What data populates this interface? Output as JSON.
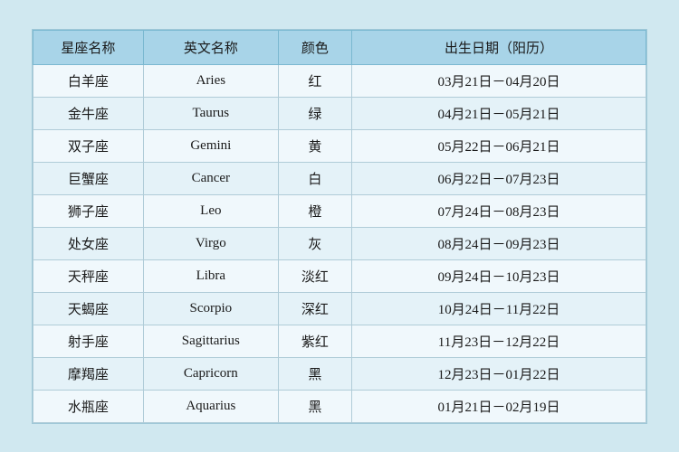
{
  "table": {
    "headers": [
      "星座名称",
      "英文名称",
      "颜色",
      "出生日期（阳历）"
    ],
    "rows": [
      {
        "name": "白羊座",
        "english": "Aries",
        "color": "红",
        "date": "03月21日－04月20日"
      },
      {
        "name": "金牛座",
        "english": "Taurus",
        "color": "绿",
        "date": "04月21日－05月21日"
      },
      {
        "name": "双子座",
        "english": "Gemini",
        "color": "黄",
        "date": "05月22日－06月21日"
      },
      {
        "name": "巨蟹座",
        "english": "Cancer",
        "color": "白",
        "date": "06月22日－07月23日"
      },
      {
        "name": "狮子座",
        "english": "Leo",
        "color": "橙",
        "date": "07月24日－08月23日"
      },
      {
        "name": "处女座",
        "english": "Virgo",
        "color": "灰",
        "date": "08月24日－09月23日"
      },
      {
        "name": "天秤座",
        "english": "Libra",
        "color": "淡红",
        "date": "09月24日－10月23日"
      },
      {
        "name": "天蝎座",
        "english": "Scorpio",
        "color": "深红",
        "date": "10月24日－11月22日"
      },
      {
        "name": "射手座",
        "english": "Sagittarius",
        "color": "紫红",
        "date": "11月23日－12月22日"
      },
      {
        "name": "摩羯座",
        "english": "Capricorn",
        "color": "黑",
        "date": "12月23日－01月22日"
      },
      {
        "name": "水瓶座",
        "english": "Aquarius",
        "color": "黑",
        "date": "01月21日－02月19日"
      }
    ]
  }
}
